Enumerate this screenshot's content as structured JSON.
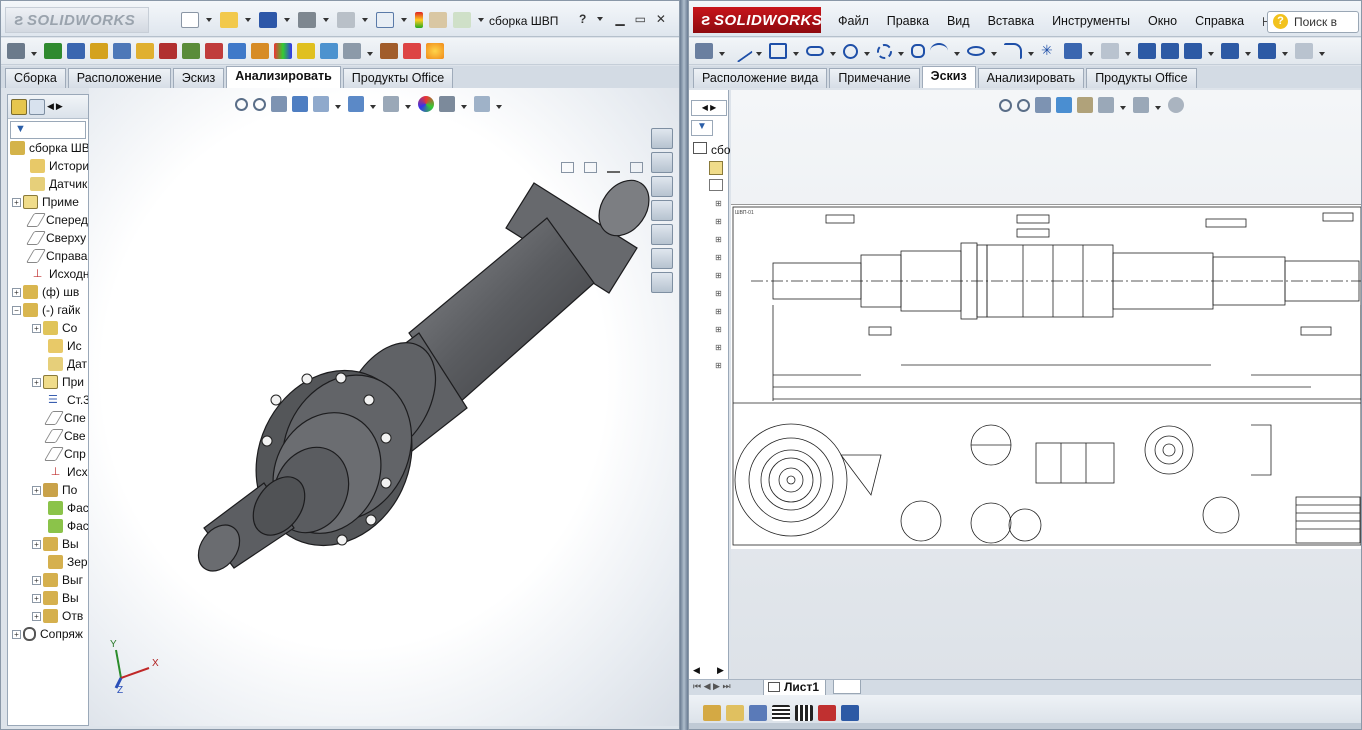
{
  "left_window": {
    "brand": "SOLIDWORKS",
    "doc_title": "сборка ШВП",
    "help_label": "?",
    "tabs": [
      "Сборка",
      "Расположение",
      "Эскиз",
      "Анализировать",
      "Продукты Office"
    ],
    "active_tab": "Анализировать",
    "tree": {
      "root": "сборка ШВ",
      "items": [
        "Истори",
        "Датчик",
        "Приме",
        "Сперед",
        "Сверху",
        "Справа",
        "Исходн",
        "(ф) шв",
        "(-) гайк"
      ],
      "subitems": [
        "Со",
        "Ис",
        "Дат",
        "При",
        "Ст.3",
        "Спе",
        "Све",
        "Спр",
        "Исх",
        "По",
        "Фас",
        "Фас",
        "Вы",
        "Зер",
        "Выг",
        "Вы",
        "Отв"
      ],
      "last": "Сопряж"
    },
    "triad": {
      "x": "X",
      "y": "Y",
      "z": "Z"
    }
  },
  "right_window": {
    "brand": "SOLIDWORKS",
    "menu": [
      "Файл",
      "Правка",
      "Вид",
      "Вставка",
      "Инструменты",
      "Окно",
      "Справка"
    ],
    "search_placeholder": "Поиск в",
    "tabs": [
      "Расположение вида",
      "Примечание",
      "Эскиз",
      "Анализировать",
      "Продукты Office"
    ],
    "active_tab": "Эскиз",
    "tree_label": "сбо",
    "sheet_tab": "Лист1",
    "drawing_label": "ШВП-01"
  },
  "colors": {
    "brand_red": "#b3121a",
    "part_gray": "#5e6064"
  }
}
